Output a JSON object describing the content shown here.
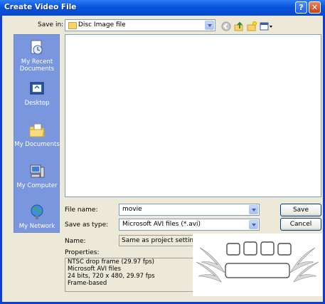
{
  "title": "Create Video File",
  "title_buttons": {
    "help": "?",
    "close": "✕"
  },
  "save_in": {
    "label": "Save in:",
    "value": "Disc Image file"
  },
  "places": [
    {
      "label_line1": "My Recent",
      "label_line2": "Documents",
      "icon": "recent-documents-icon"
    },
    {
      "label_line1": "Desktop",
      "label_line2": "",
      "icon": "desktop-icon"
    },
    {
      "label_line1": "My Documents",
      "label_line2": "",
      "icon": "my-documents-icon"
    },
    {
      "label_line1": "My Computer",
      "label_line2": "",
      "icon": "my-computer-icon"
    },
    {
      "label_line1": "My Network",
      "label_line2": "",
      "icon": "my-network-icon"
    }
  ],
  "file_name": {
    "label": "File name:",
    "value": "movie"
  },
  "save_as_type": {
    "label": "Save as type:",
    "value": "Microsoft AVI files (*.avi)"
  },
  "buttons": {
    "save": "Save",
    "cancel": "Cancel"
  },
  "name": {
    "label": "Name:",
    "value": "Same as project settings"
  },
  "properties": {
    "label": "Properties:",
    "lines": [
      "NTSC drop frame (29.97 fps)",
      "Microsoft AVI files",
      "24 bits, 720 x 480, 29.97 fps",
      "Frame-based"
    ]
  },
  "colors": {
    "title_bar": "#0855dd",
    "places_bar": "#7a96df",
    "dialog": "#ece9d8"
  }
}
